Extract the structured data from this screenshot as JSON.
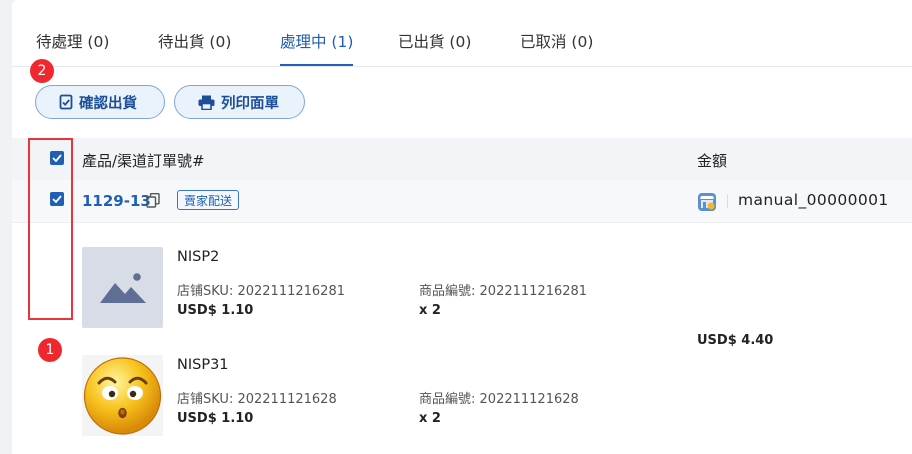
{
  "tabs": [
    {
      "label": "待處理 (0)"
    },
    {
      "label": "待出貨 (0)"
    },
    {
      "label": "處理中 (1)"
    },
    {
      "label": "已出貨 (0)"
    },
    {
      "label": "已取消 (0)"
    }
  ],
  "active_tab_index": 2,
  "annotations": {
    "badge_top": "2",
    "badge_bottom": "1"
  },
  "toolbar": {
    "confirm_ship_label": "確認出貨",
    "print_label": "列印面單"
  },
  "table": {
    "col_product": "產品/渠道訂單號#",
    "col_amount": "金額"
  },
  "order": {
    "number": "1129-13",
    "tag": "賣家配送",
    "store": "manual_00000001",
    "total": "USD$ 4.40",
    "select_all_checked": true,
    "row_checked": true,
    "items": [
      {
        "name": "NISP2",
        "sku_label": "店铺SKU:",
        "sku": "2022111216281",
        "code_label": "商品編號:",
        "code": "2022111216281",
        "price": "USD$ 1.10",
        "qty": "x 2"
      },
      {
        "name": "NISP31",
        "sku_label": "店铺SKU:",
        "sku": "202211121628",
        "code_label": "商品編號:",
        "code": "202211121628",
        "price": "USD$ 1.10",
        "qty": "x 2"
      }
    ]
  },
  "colors": {
    "accent": "#1f5fb5",
    "annotation_red": "#e8343a"
  },
  "icons": [
    "checklist-icon",
    "printer-icon",
    "copy-icon",
    "store-icon",
    "image-placeholder-icon",
    "emoji-face-image"
  ]
}
